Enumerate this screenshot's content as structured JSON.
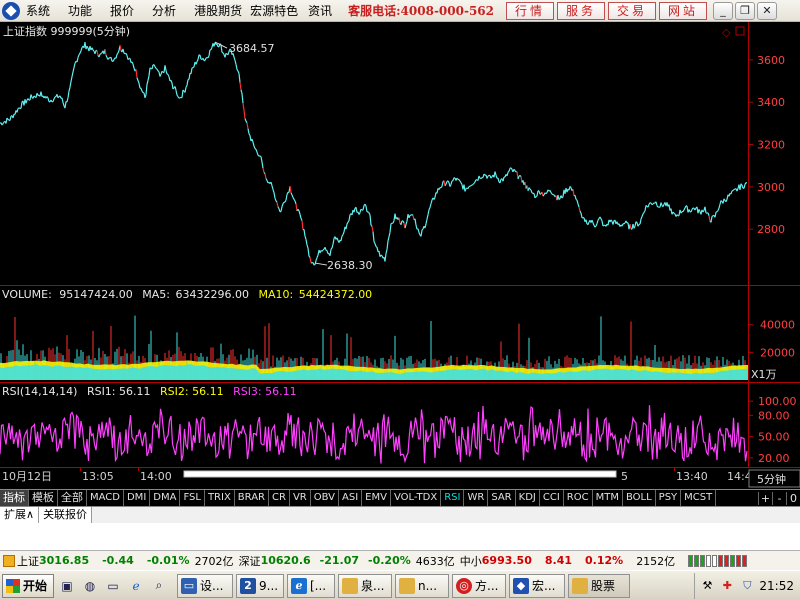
{
  "menu": {
    "items": [
      "系统",
      "功能",
      "报价",
      "分析",
      "港股期货",
      "宏源特色",
      "资讯"
    ],
    "hotline": "客服电话:4008-000-562",
    "quick_buttons": [
      "行情",
      "服务",
      "交易",
      "网站"
    ],
    "window_buttons": [
      "minimize",
      "restore",
      "close"
    ]
  },
  "price_panel": {
    "title": "上证指数 999999(5分钟)",
    "high_label": "3684.57",
    "low_label": "2638.30",
    "y_ticks": [
      "3600",
      "3400",
      "3200",
      "3000",
      "2800"
    ]
  },
  "volume_panel": {
    "label": "VOLUME:",
    "volume": "95147424.00",
    "ma5_label": "MA5:",
    "ma5": "63432296.00",
    "ma10_label": "MA10:",
    "ma10": "54424372.00",
    "y_ticks": [
      "40000",
      "20000"
    ],
    "unit": "X1万"
  },
  "rsi_panel": {
    "label": "RSI(14,14,14)",
    "rsi1": "RSI1: 56.11",
    "rsi2": "RSI2: 56.11",
    "rsi3": "RSI3: 56.11",
    "y_ticks": [
      "100.00",
      "80.00",
      "50.00",
      "20.00"
    ]
  },
  "time_axis": {
    "labels": [
      "10月12日",
      "13:05",
      "14:00",
      "5",
      "13:40",
      "14:4"
    ],
    "period_button": "5分钟"
  },
  "indicator_tabs": [
    "指标",
    "模板",
    "全部",
    "MACD",
    "DMI",
    "DMA",
    "FSL",
    "TRIX",
    "BRAR",
    "CR",
    "VR",
    "OBV",
    "ASI",
    "EMV",
    "VOL-TDX",
    "RSI",
    "WR",
    "SAR",
    "KDJ",
    "CCI",
    "ROC",
    "MTM",
    "BOLL",
    "PSY",
    "MCST"
  ],
  "tab_controls": [
    "+",
    "-",
    "0"
  ],
  "sub_tabs": [
    "扩展∧",
    "关联报价"
  ],
  "ticker": {
    "sh_name": "上证",
    "sh_price": "3016.85",
    "sh_change": "-0.44",
    "sh_pct": "-0.01%",
    "sh_amount": "2702亿",
    "sz_name": "深证",
    "sz_price": "10620.6",
    "sz_change": "-21.07",
    "sz_pct": "-0.20%",
    "sz_amount": "4633亿",
    "sm_name": "中小",
    "sm_price": "6993.50",
    "sm_change": "8.41",
    "sm_pct": "0.12%",
    "sm_amount": "2152亿"
  },
  "taskbar": {
    "start": "开始",
    "tasks": [
      "设...",
      "9...",
      "[...",
      "泉...",
      "n...",
      "方...",
      "宏...",
      "股票"
    ],
    "clock": "21:52"
  },
  "colors": {
    "price_line": "#5ef0f0",
    "down_tick": "#ff3030",
    "ma5": "#ffffff",
    "ma10": "#ffff00",
    "rsi1": "#ffffff",
    "rsi2": "#ffff00",
    "rsi3": "#ff40ff",
    "axis_red": "#b00000"
  },
  "chart_data": {
    "type": "line",
    "price_series": {
      "points": [
        [
          0,
          3300
        ],
        [
          10,
          3320
        ],
        [
          20,
          3380
        ],
        [
          30,
          3420
        ],
        [
          40,
          3440
        ],
        [
          50,
          3410
        ],
        [
          60,
          3430
        ],
        [
          65,
          3380
        ],
        [
          70,
          3460
        ],
        [
          75,
          3580
        ],
        [
          80,
          3640
        ],
        [
          85,
          3670
        ],
        [
          90,
          3650
        ],
        [
          95,
          3640
        ],
        [
          100,
          3620
        ],
        [
          105,
          3640
        ],
        [
          110,
          3600
        ],
        [
          115,
          3610
        ],
        [
          120,
          3660
        ],
        [
          125,
          3640
        ],
        [
          130,
          3600
        ],
        [
          135,
          3560
        ],
        [
          140,
          3480
        ],
        [
          145,
          3420
        ],
        [
          150,
          3550
        ],
        [
          155,
          3570
        ],
        [
          160,
          3520
        ],
        [
          165,
          3560
        ],
        [
          170,
          3500
        ],
        [
          175,
          3460
        ],
        [
          180,
          3420
        ],
        [
          185,
          3460
        ],
        [
          190,
          3530
        ],
        [
          195,
          3580
        ],
        [
          200,
          3620
        ],
        [
          205,
          3600
        ],
        [
          210,
          3640
        ],
        [
          215,
          3684
        ],
        [
          220,
          3670
        ],
        [
          225,
          3620
        ],
        [
          230,
          3640
        ],
        [
          235,
          3610
        ],
        [
          240,
          3500
        ],
        [
          245,
          3320
        ],
        [
          250,
          3240
        ],
        [
          255,
          3180
        ],
        [
          260,
          3150
        ],
        [
          265,
          3050
        ],
        [
          270,
          3020
        ],
        [
          275,
          2960
        ],
        [
          280,
          2880
        ],
        [
          285,
          2940
        ],
        [
          290,
          3000
        ],
        [
          295,
          2920
        ],
        [
          300,
          2860
        ],
        [
          305,
          2780
        ],
        [
          310,
          2660
        ],
        [
          315,
          2640
        ],
        [
          320,
          2700
        ],
        [
          325,
          2720
        ],
        [
          330,
          2680
        ],
        [
          335,
          2760
        ],
        [
          340,
          2740
        ],
        [
          345,
          2800
        ],
        [
          350,
          2860
        ],
        [
          355,
          2900
        ],
        [
          360,
          2880
        ],
        [
          365,
          2920
        ],
        [
          370,
          2860
        ],
        [
          375,
          2720
        ],
        [
          380,
          2680
        ],
        [
          385,
          2660
        ],
        [
          390,
          2800
        ],
        [
          395,
          2860
        ],
        [
          400,
          2840
        ],
        [
          405,
          2820
        ],
        [
          410,
          2880
        ],
        [
          415,
          2850
        ],
        [
          420,
          2760
        ],
        [
          425,
          2820
        ],
        [
          430,
          2900
        ],
        [
          435,
          2960
        ],
        [
          440,
          3000
        ],
        [
          445,
          3020
        ],
        [
          450,
          3010
        ],
        [
          455,
          3040
        ],
        [
          460,
          3020
        ],
        [
          465,
          2990
        ],
        [
          470,
          3010
        ],
        [
          475,
          3030
        ],
        [
          480,
          3050
        ],
        [
          485,
          3060
        ],
        [
          490,
          3040
        ],
        [
          495,
          3060
        ],
        [
          500,
          3030
        ],
        [
          505,
          3040
        ],
        [
          510,
          3080
        ],
        [
          515,
          3070
        ],
        [
          520,
          3040
        ],
        [
          525,
          3010
        ],
        [
          530,
          2980
        ],
        [
          535,
          2960
        ],
        [
          540,
          2980
        ],
        [
          545,
          2960
        ],
        [
          550,
          2990
        ],
        [
          555,
          2960
        ],
        [
          560,
          2940
        ],
        [
          565,
          2980
        ],
        [
          570,
          3000
        ],
        [
          575,
          2960
        ],
        [
          580,
          2880
        ],
        [
          585,
          2830
        ],
        [
          590,
          2840
        ],
        [
          595,
          2820
        ],
        [
          600,
          2850
        ],
        [
          605,
          2810
        ],
        [
          610,
          2840
        ],
        [
          615,
          2830
        ],
        [
          620,
          2820
        ],
        [
          625,
          2830
        ],
        [
          630,
          2810
        ],
        [
          635,
          2820
        ],
        [
          640,
          2830
        ],
        [
          645,
          2900
        ],
        [
          650,
          2920
        ],
        [
          655,
          2930
        ],
        [
          660,
          2910
        ],
        [
          665,
          2920
        ],
        [
          670,
          2900
        ],
        [
          675,
          2860
        ],
        [
          680,
          2880
        ],
        [
          685,
          2900
        ],
        [
          690,
          2890
        ],
        [
          695,
          2900
        ],
        [
          700,
          2880
        ],
        [
          705,
          2900
        ],
        [
          710,
          2840
        ],
        [
          715,
          2860
        ],
        [
          720,
          2920
        ],
        [
          725,
          2940
        ],
        [
          730,
          2960
        ],
        [
          735,
          2980
        ],
        [
          740,
          3000
        ],
        [
          748,
          3016
        ]
      ],
      "ylim": [
        2560,
        3760
      ]
    },
    "volume_series": {
      "ylim": [
        0,
        55000
      ]
    },
    "rsi_series": {
      "ylim": [
        10,
        110
      ]
    }
  }
}
